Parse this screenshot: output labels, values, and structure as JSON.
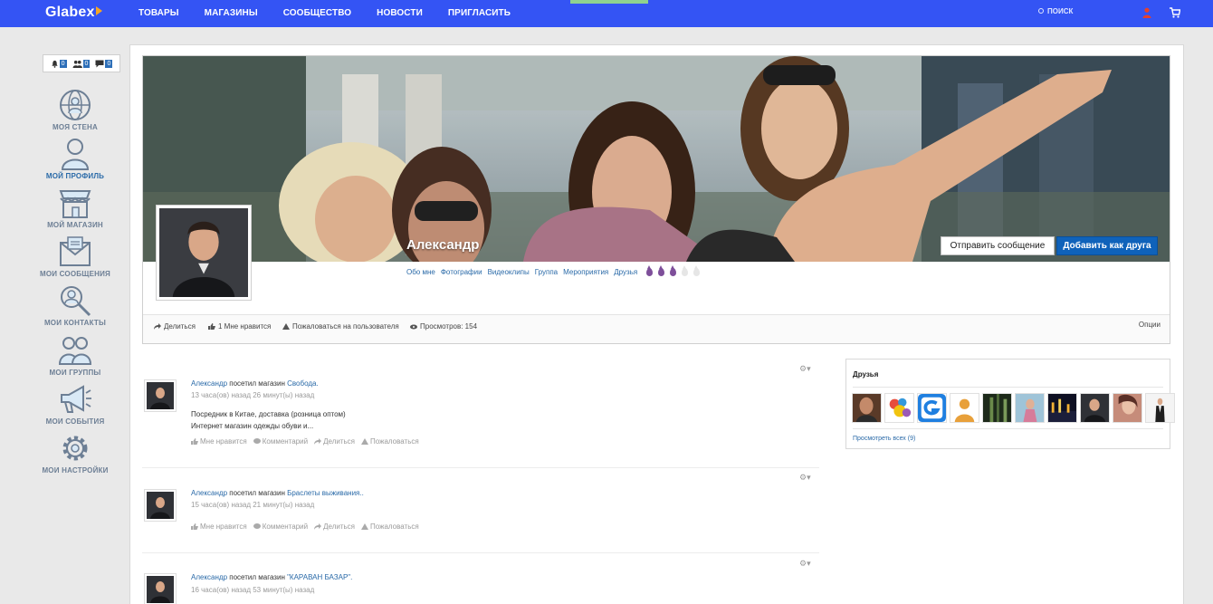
{
  "app": {
    "logo": "Glabex"
  },
  "nav": {
    "items": [
      "ТОВАРЫ",
      "МАГАЗИНЫ",
      "СООБЩЕСТВО",
      "НОВОСТИ",
      "ПРИГЛАСИТЬ"
    ],
    "search_label": "ПОИСК"
  },
  "notifications": {
    "bell": "0",
    "friends": "0",
    "messages": "0"
  },
  "sidebar": {
    "items": [
      {
        "label": "МОЯ СТЕНА",
        "icon": "globe-person-icon"
      },
      {
        "label": "МОЙ ПРОФИЛЬ",
        "icon": "profile-icon"
      },
      {
        "label": "МОЙ МАГАЗИН",
        "icon": "shop-icon"
      },
      {
        "label": "МОИ СООБЩЕНИЯ",
        "icon": "envelope-icon"
      },
      {
        "label": "МОИ КОНТАКТЫ",
        "icon": "contacts-search-icon"
      },
      {
        "label": "МОИ ГРУППЫ",
        "icon": "group-icon"
      },
      {
        "label": "МОИ СОБЫТИЯ",
        "icon": "megaphone-icon"
      },
      {
        "label": "МОИ НАСТРОЙКИ",
        "icon": "gear-icon"
      }
    ]
  },
  "profile": {
    "name": "Александр",
    "send_message_label": "Отправить сообщение",
    "add_friend_label": "Добавить как друга",
    "tabs": [
      "Обо мне",
      "Фотографии",
      "Видеоклипы",
      "Группа",
      "Мероприятия",
      "Друзья"
    ],
    "rating": {
      "filled": 3,
      "total": 5
    },
    "actions": {
      "share": "Делиться",
      "likes": "1 Мне нравится",
      "report": "Пожаловаться на пользователя",
      "views": "Просмотров: 154",
      "options": "Опции"
    }
  },
  "feed": {
    "posts": [
      {
        "author": "Александр",
        "verb": "посетил магазин",
        "shop": "Свобода.",
        "time": "13 часа(ов) назад 26 минут(ы) назад",
        "body": [
          "Посредник в Китае, доставка (розница оптом)",
          "Интернет магазин одежды обуви и..."
        ]
      },
      {
        "author": "Александр",
        "verb": "посетил магазин",
        "shop": "Браслеты выживания..",
        "time": "15 часа(ов) назад 21 минут(ы) назад",
        "body": []
      },
      {
        "author": "Александр",
        "verb": "посетил магазин",
        "shop": "\"КАРАВАН БАЗАР\".",
        "time": "16 часа(ов) назад 53 минут(ы) назад",
        "body": []
      }
    ],
    "post_actions": {
      "like": "Мне нравится",
      "comment": "Комментарий",
      "share": "Делиться",
      "report": "Пожаловаться"
    }
  },
  "friends_widget": {
    "title": "Друзья",
    "view_all": "Просмотреть всех (9)"
  },
  "colors": {
    "topbar": "#3454f4",
    "primary_button": "#0f62ba",
    "link": "#2a6aa8",
    "rating_filled": "#7e4f9a"
  }
}
